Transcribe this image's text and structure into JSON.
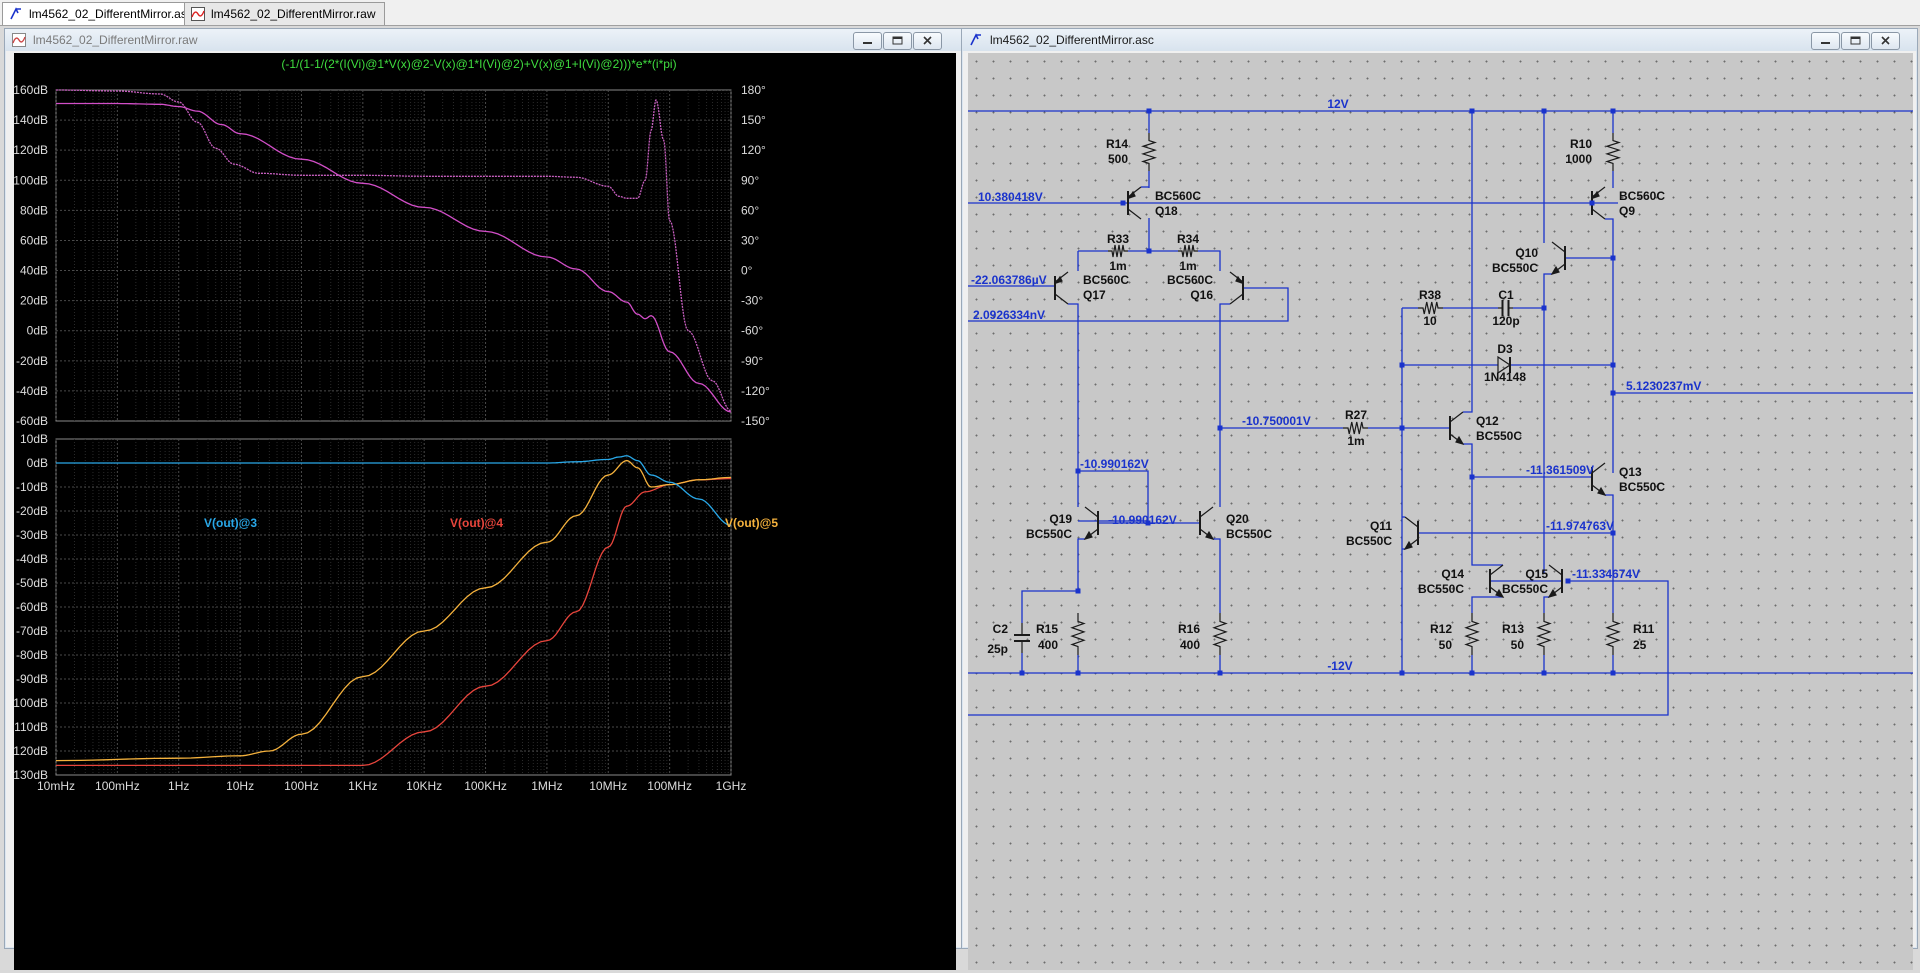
{
  "tabs": [
    {
      "label": "lm4562_02_DifferentMirror.asc",
      "active": true,
      "icon": "schematic-icon"
    },
    {
      "label": "lm4562_02_DifferentMirror.raw",
      "active": false,
      "icon": "waveform-icon"
    }
  ],
  "plot_window": {
    "title": "lm4562_02_DifferentMirror.raw",
    "top_trace_expr": "(-1/(1-1/(2*(I(Vi)@1*V(x)@2-V(x)@1*I(Vi)@2)+V(x)@1+I(Vi)@2)))*e**(i*pi)",
    "colors": {
      "magnitude": "#d24ec8",
      "phase": "#c85fc0",
      "v3": "#29a8e8",
      "v4": "#e8453c",
      "v5": "#f5b23d",
      "expr": "#3fdc3f",
      "axis_text": "#dcdcdc"
    }
  },
  "schematic_window": {
    "title": "lm4562_02_DifferentMirror.asc",
    "wire_color": "#1a33cc"
  },
  "chart_data": [
    {
      "type": "line",
      "title": "(-1/(1-1/(2*(I(Vi)@1*V(x)@2-V(x)@1*I(Vi)@2)+V(x)@1+I(Vi)@2)))*e**(i*pi)",
      "xscale": "log",
      "xlim": [
        0.01,
        1000000000
      ],
      "xticks": [
        "10mHz",
        "100mHz",
        "1Hz",
        "10Hz",
        "100Hz",
        "1KHz",
        "10KHz",
        "100KHz",
        "1MHz",
        "10MHz",
        "100MHz",
        "1GHz"
      ],
      "ylim": [
        -60,
        160
      ],
      "yticks": [
        "160dB",
        "140dB",
        "120dB",
        "100dB",
        "80dB",
        "60dB",
        "40dB",
        "20dB",
        "0dB",
        "-20dB",
        "-40dB",
        "-60dB"
      ],
      "y2lim": [
        -150,
        180
      ],
      "y2ticks": [
        "180°",
        "150°",
        "120°",
        "90°",
        "60°",
        "30°",
        "0°",
        "-30°",
        "-60°",
        "-90°",
        "-120°",
        "-150°"
      ],
      "series": [
        {
          "name": "magnitude",
          "axis": "left",
          "x": [
            0.01,
            0.1,
            0.5,
            1,
            2,
            5,
            10,
            100,
            1000,
            10000,
            100000,
            1000000,
            3000000,
            10000000,
            20000000,
            30000000,
            40000000,
            50000000,
            100000000,
            300000000,
            1000000000
          ],
          "y": [
            151,
            151,
            150.5,
            149,
            146,
            137,
            131,
            114,
            98,
            82,
            66,
            49,
            41,
            26,
            19,
            11,
            8,
            10,
            -14,
            -35,
            -54
          ]
        },
        {
          "name": "phase",
          "axis": "right",
          "x": [
            0.01,
            0.1,
            0.5,
            1,
            2,
            4,
            8,
            20,
            100,
            1000,
            10000,
            100000,
            1000000,
            3000000,
            10000000,
            15000000,
            20000000,
            30000000,
            40000000,
            50000000,
            60000000,
            80000000,
            100000000,
            200000000,
            500000000,
            1000000000
          ],
          "y": [
            180,
            179,
            176,
            168,
            148,
            122,
            106,
            97,
            95,
            95,
            94,
            94,
            94,
            93,
            84,
            74,
            72,
            72,
            90,
            140,
            170,
            130,
            50,
            -60,
            -110,
            -140
          ]
        }
      ]
    },
    {
      "type": "line",
      "xscale": "log",
      "xlim": [
        0.01,
        1000000000
      ],
      "xticks": [
        "10mHz",
        "100mHz",
        "1Hz",
        "10Hz",
        "100Hz",
        "1KHz",
        "10KHz",
        "100KHz",
        "1MHz",
        "10MHz",
        "100MHz",
        "1GHz"
      ],
      "ylim": [
        -130,
        10
      ],
      "yticks": [
        "10dB",
        "0dB",
        "-10dB",
        "-20dB",
        "-30dB",
        "-40dB",
        "-50dB",
        "-60dB",
        "-70dB",
        "-80dB",
        "-90dB",
        "-100dB",
        "-110dB",
        "-120dB",
        "-130dB"
      ],
      "legend": [
        "V(out)@3",
        "V(out)@4",
        "V(out)@5"
      ],
      "series": [
        {
          "name": "V(out)@3",
          "x": [
            0.01,
            1000,
            1000000,
            3000000,
            10000000,
            15000000,
            20000000,
            30000000,
            50000000,
            100000000,
            300000000,
            1000000000
          ],
          "y": [
            0,
            0,
            0,
            0.5,
            1.5,
            2.5,
            3,
            1,
            -5,
            -8,
            -15,
            -26
          ]
        },
        {
          "name": "V(out)@4",
          "x": [
            0.01,
            10,
            100,
            1000,
            10000,
            100000,
            1000000,
            3000000,
            10000000,
            20000000,
            40000000,
            100000000,
            300000000,
            1000000000
          ],
          "y": [
            -126,
            -126,
            -126,
            -126,
            -112,
            -93,
            -74,
            -62,
            -35,
            -18,
            -12,
            -9,
            -7,
            -6.5
          ]
        },
        {
          "name": "V(out)@5",
          "x": [
            0.01,
            1,
            10,
            30,
            100,
            1000,
            10000,
            100000,
            1000000,
            3000000,
            10000000,
            20000000,
            30000000,
            50000000,
            100000000,
            300000000,
            1000000000
          ],
          "y": [
            -124,
            -123,
            -122,
            -120,
            -113,
            -89,
            -70,
            -52,
            -33,
            -22,
            -5,
            1,
            -2,
            -10,
            -9,
            -7,
            -6
          ]
        }
      ]
    }
  ],
  "schematic": {
    "net_labels": {
      "vcc": "12V",
      "vee": "-12V",
      "n1": "10.380418V",
      "n2": "-22.063786µV",
      "n3": "2.0926334nV",
      "n4": "-10.990162V",
      "n5": "-10.990162V",
      "n6": "-10.750001V",
      "n7": "5.1230237mV",
      "n8": "-11.361509V",
      "n9": "-11.974763V",
      "n10": "-11.334674V"
    },
    "components": {
      "R14": {
        "name": "R14",
        "value": "500"
      },
      "R10": {
        "name": "R10",
        "value": "1000"
      },
      "R33": {
        "name": "R33",
        "value": "1m"
      },
      "R34": {
        "name": "R34",
        "value": "1m"
      },
      "R38": {
        "name": "R38",
        "value": "10"
      },
      "C1": {
        "name": "C1",
        "value": "120p"
      },
      "D3": {
        "name": "D3",
        "value": "1N4148"
      },
      "R27": {
        "name": "R27",
        "value": "1m"
      },
      "C2": {
        "name": "C2",
        "value": "25p"
      },
      "R15": {
        "name": "R15",
        "value": "400"
      },
      "R16": {
        "name": "R16",
        "value": "400"
      },
      "R12": {
        "name": "R12",
        "value": "50"
      },
      "R13": {
        "name": "R13",
        "value": "50"
      },
      "R11": {
        "name": "R11",
        "value": "25"
      },
      "Q18": {
        "name": "Q18",
        "value": "BC560C"
      },
      "Q9": {
        "name": "Q9",
        "value": "BC560C"
      },
      "Q17": {
        "name": "Q17",
        "value": "BC560C"
      },
      "Q16": {
        "name": "Q16",
        "value": "BC560C"
      },
      "Q10": {
        "name": "Q10",
        "value": "BC550C"
      },
      "Q12": {
        "name": "Q12",
        "value": "BC550C"
      },
      "Q13": {
        "name": "Q13",
        "value": "BC550C"
      },
      "Q19": {
        "name": "Q19",
        "value": "BC550C"
      },
      "Q20": {
        "name": "Q20",
        "value": "BC550C"
      },
      "Q11": {
        "name": "Q11",
        "value": "BC550C"
      },
      "Q14": {
        "name": "Q14",
        "value": "BC550C"
      },
      "Q15": {
        "name": "Q15",
        "value": "BC550C"
      }
    }
  }
}
